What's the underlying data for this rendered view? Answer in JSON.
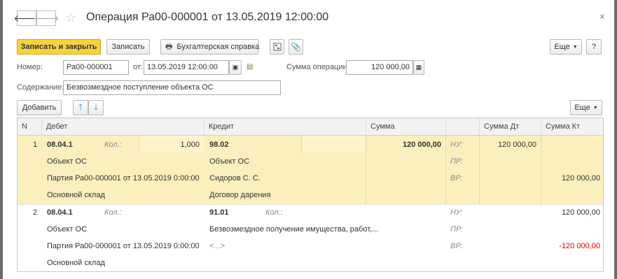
{
  "window": {
    "title": "Операция Ра00-000001 от 13.05.2019 12:00:00",
    "close": "×"
  },
  "toolbar": {
    "post_close": "Записать и закрыть",
    "save": "Записать",
    "report": "Бухгалтерская справка",
    "more": "Еще",
    "help": "?"
  },
  "form": {
    "number_label": "Номер:",
    "number_value": "Ра00-000001",
    "date_label": "от:",
    "date_value": "13.05.2019 12:00:00",
    "sum_label": "Сумма операции:",
    "sum_value": "120 000,00",
    "content_label": "Содержание:",
    "content_value": "Безвозмездное поступление объекта ОС"
  },
  "table_toolbar": {
    "add": "Добавить",
    "more": "Еще"
  },
  "table": {
    "columns": [
      "N",
      "Дебет",
      "Кредит",
      "Сумма",
      "Сумма Дт",
      "Сумма Кт"
    ],
    "rows": [
      {
        "n": "1",
        "debit_account": "08.04.1",
        "debit_qty_label": "Кол.:",
        "debit_qty": "1,000",
        "debit_sub1": "Объект ОС",
        "debit_sub2": "Партия Ра00-000001 от 13.05.2019 0:00:00",
        "debit_sub3": "Основной склад",
        "credit_account": "98.02",
        "credit_qty_label": "",
        "credit_sub1": "Объект ОС",
        "credit_sub2": "Сидоров С. С.",
        "credit_sub3": "Договор дарения",
        "sum": "120 000,00",
        "nu_label": "НУ:",
        "pr_label": "ПР:",
        "vr_label": "ВР:",
        "nu_dt": "120 000,00",
        "nu_kt": "",
        "pr_dt": "",
        "pr_kt": "",
        "vr_dt": "",
        "vr_kt": "120 000,00"
      },
      {
        "n": "2",
        "debit_account": "08.04.1",
        "debit_qty_label": "Кол.:",
        "debit_qty": "",
        "debit_sub1": "Объект ОС",
        "debit_sub2": "Партия Ра00-000001 от 13.05.2019 0:00:00",
        "debit_sub3": "Основной склад",
        "credit_account": "91.01",
        "credit_qty_label": "Кол.:",
        "credit_sub1": "Безвозмездное получение имущества, работ,...",
        "credit_sub2": "<...>",
        "credit_sub3": "",
        "sum": "",
        "nu_label": "НУ:",
        "pr_label": "ПР:",
        "vr_label": "ВР:",
        "nu_dt": "",
        "nu_kt": "120 000,00",
        "pr_dt": "",
        "pr_kt": "",
        "vr_dt": "",
        "vr_kt": "-120 000,00"
      }
    ]
  },
  "colors": {
    "accent_yellow": "#f7d23e",
    "selected_row": "#fbefbe",
    "negative": "#dd0000"
  }
}
